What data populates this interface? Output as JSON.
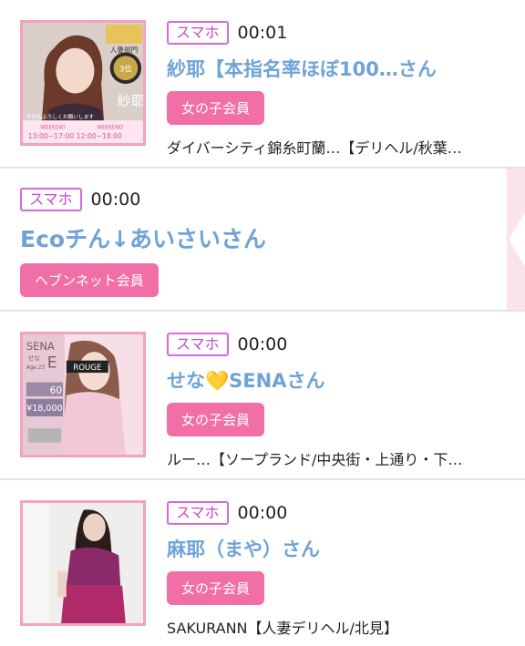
{
  "items": [
    {
      "device_tag": "スマホ",
      "time": "00:01",
      "name": "紗耶【本指名率ほぼ100…さん",
      "member_badge": "女の子会員",
      "shop": "ダイバーシティ錦糸町蘭…【デリヘル/秋葉…",
      "thumbnail_text": {
        "ranking": "人妻部門",
        "rank_num": "3位",
        "name_vertical": "紗耶",
        "message": "今日もよろしくお願いします",
        "weekday": "WEEKDAY",
        "weekend": "WEEKEND",
        "hours": "13:00~17:00  12:00~18:00"
      }
    },
    {
      "device_tag": "スマホ",
      "time": "00:00",
      "name": "Ecoチん↓あいさいさん",
      "member_badge": "ヘブンネット会員"
    },
    {
      "device_tag": "スマホ",
      "time": "00:00",
      "name": "せな💛SENAさん",
      "member_badge": "女の子会員",
      "shop": "ルー…【ソープランド/中央街・上通り・下…",
      "thumbnail_text": {
        "name_en": "SENA",
        "name_jp": "せな",
        "age": "Age.23",
        "logo": "ROUGE",
        "initial": "E",
        "minutes": "60",
        "price": "¥18,000"
      }
    },
    {
      "device_tag": "スマホ",
      "time": "00:00",
      "name": "麻耶（まや）さん",
      "member_badge": "女の子会員",
      "shop": "SAKURANN【人妻デリヘル/北見】"
    }
  ],
  "colors": {
    "accent_pink": "#f16fa6",
    "name_blue": "#6fa3d6",
    "tag_purple": "#c44bc4"
  }
}
